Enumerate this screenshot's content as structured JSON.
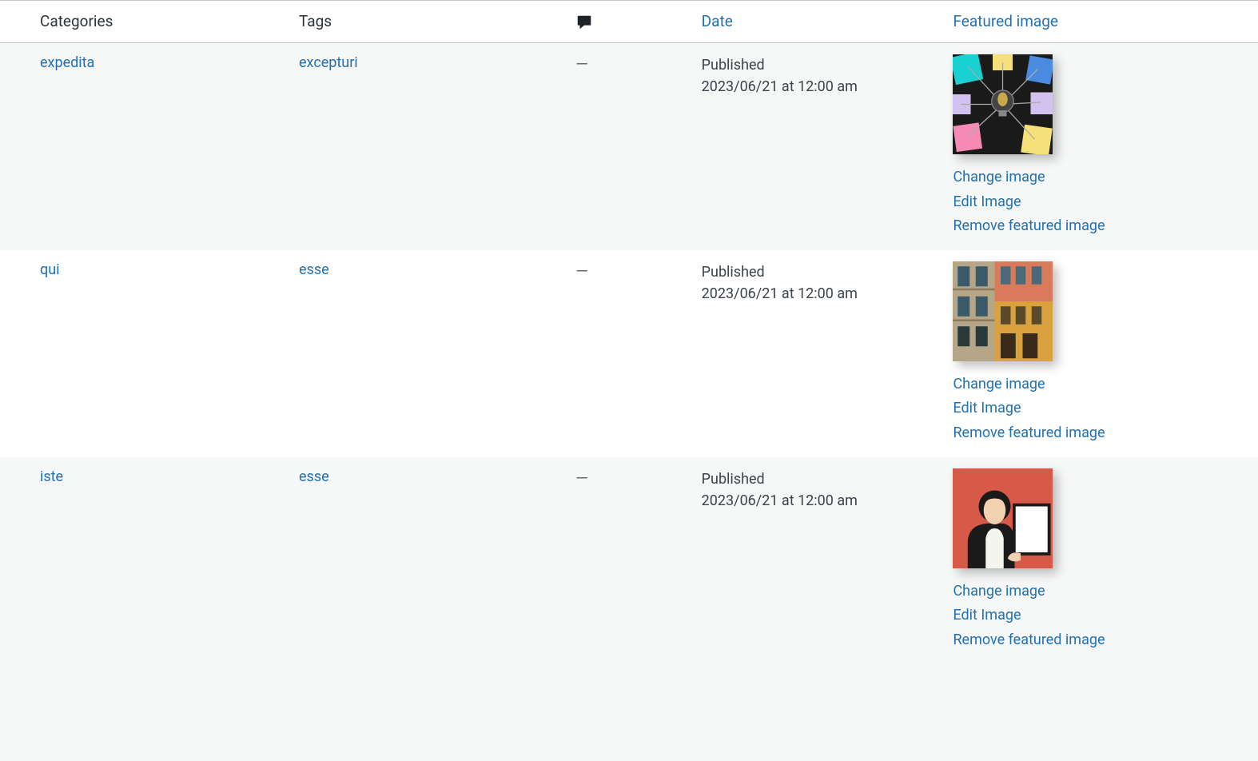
{
  "headers": {
    "categories": "Categories",
    "tags": "Tags",
    "date": "Date",
    "featured": "Featured image"
  },
  "actions": {
    "change": "Change image",
    "edit": "Edit Image",
    "remove": "Remove featured image"
  },
  "rows": [
    {
      "category": "expedita",
      "tag": "excepturi",
      "comments": "—",
      "date_status": "Published",
      "date_time": "2023/06/21 at 12:00 am",
      "thumb": "bulb"
    },
    {
      "category": "qui",
      "tag": "esse",
      "comments": "—",
      "date_status": "Published",
      "date_time": "2023/06/21 at 12:00 am",
      "thumb": "building"
    },
    {
      "category": "iste",
      "tag": "esse",
      "comments": "—",
      "date_status": "Published",
      "date_time": "2023/06/21 at 12:00 am",
      "thumb": "person"
    }
  ]
}
